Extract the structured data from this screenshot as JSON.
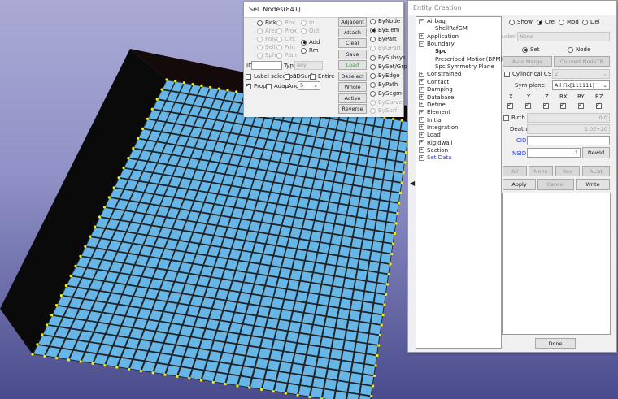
{
  "sel_nodes": {
    "title": "Sel. Nodes(841)",
    "modes_col1": [
      "Pick",
      "Area",
      "Poly",
      "Sell",
      "Sphe"
    ],
    "modes_col2": [
      "Box",
      "Prox",
      "Circ",
      "Frin",
      "Plan"
    ],
    "modes_col3": [
      "In",
      "Out"
    ],
    "add_label": "Add",
    "rm_label": "Rm",
    "id_label": "ID",
    "type_label": "Type",
    "type_value": "any",
    "label_selection": "Label selection",
    "surf3d": "3DSurf",
    "entire": "Entire",
    "prop": "Prop",
    "adap": "Adap",
    "ang_label": "Ang",
    "ang_value": "5",
    "buttons": [
      "Adjacent",
      "Attach",
      "Clear",
      "Save",
      "Load",
      "Deselect",
      "Whole",
      "Active",
      "Reverse"
    ],
    "by_options": [
      "ByNode",
      "ByElem",
      "ByPart",
      "ByGPart",
      "BySubsys",
      "BySet/Grp",
      "ByEdge",
      "ByPath",
      "BySegm",
      "ByCurve",
      "BySurf"
    ]
  },
  "entity": {
    "title": "Entity Creation",
    "tree": [
      {
        "label": "Airbag",
        "expander": "−",
        "level": 0
      },
      {
        "label": "ShellRefGM",
        "level": 1
      },
      {
        "label": "Application",
        "expander": "+",
        "level": 0
      },
      {
        "label": "Boundary",
        "expander": "−",
        "level": 0
      },
      {
        "label": "Spc",
        "level": 1,
        "bold": true
      },
      {
        "label": "Prescribed Motion(BPM)",
        "level": 1
      },
      {
        "label": "Spc Symmetry Plane",
        "level": 1
      },
      {
        "label": "Constrained",
        "expander": "+",
        "level": 0
      },
      {
        "label": "Contact",
        "expander": "+",
        "level": 0
      },
      {
        "label": "Damping",
        "expander": "+",
        "level": 0
      },
      {
        "label": "Database",
        "expander": "+",
        "level": 0
      },
      {
        "label": "Define",
        "expander": "+",
        "level": 0
      },
      {
        "label": "Element",
        "expander": "+",
        "level": 0
      },
      {
        "label": "Initial",
        "expander": "+",
        "level": 0
      },
      {
        "label": "Integration",
        "expander": "+",
        "level": 0
      },
      {
        "label": "Load",
        "expander": "+",
        "level": 0
      },
      {
        "label": "Rigidwall",
        "expander": "+",
        "level": 0
      },
      {
        "label": "Section",
        "expander": "+",
        "level": 0
      },
      {
        "label": "Set Data",
        "expander": "+",
        "level": 0,
        "blue": true
      }
    ],
    "modes": [
      "Show",
      "Cre",
      "Mod",
      "Del"
    ],
    "label_label": "Label",
    "label_value": "None",
    "set_label": "Set",
    "node_label": "Node",
    "auto_merge": "Auto Merge",
    "convert_node": "Convert NodeTR",
    "cylindrical": "Cylindrical CS",
    "cyl_value": "Z",
    "sym_plane_label": "Sym plane",
    "sym_plane_value": "All Fix[111111]",
    "dof_labels": [
      "X",
      "Y",
      "Z",
      "RX",
      "RY",
      "RZ"
    ],
    "birth_label": "Birth",
    "birth_value": "0.0",
    "death_label": "Death",
    "death_value": "1.0E+20",
    "cid_label": "CID",
    "nsid_label": "NSID",
    "nsid_value": "1",
    "newid": "NewId",
    "list_buttons": [
      "All",
      "None",
      "Rev",
      "AList"
    ],
    "apply": "Apply",
    "cancel": "Cancel",
    "write": "Write",
    "done": "Done"
  }
}
